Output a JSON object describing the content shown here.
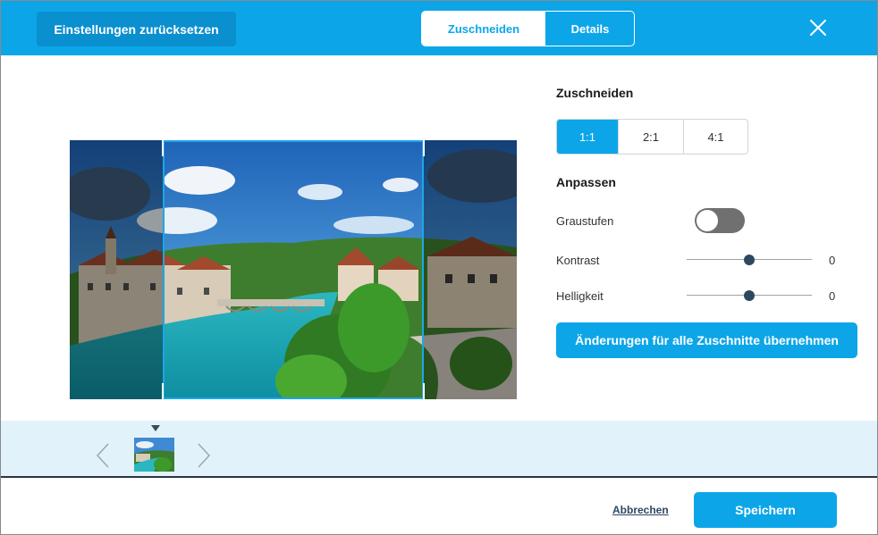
{
  "header": {
    "reset_label": "Einstellungen zurücksetzen",
    "tabs": [
      {
        "label": "Zuschneiden",
        "active": true
      },
      {
        "label": "Details",
        "active": false
      }
    ],
    "close_icon": "close-icon"
  },
  "crop": {
    "title": "Zuschneiden",
    "ratios": [
      {
        "label": "1:1",
        "active": true
      },
      {
        "label": "2:1",
        "active": false
      },
      {
        "label": "4:1",
        "active": false
      }
    ]
  },
  "adjust": {
    "title": "Anpassen",
    "grayscale_label": "Graustufen",
    "grayscale_on": false,
    "contrast_label": "Kontrast",
    "contrast_value": "0",
    "brightness_label": "Helligkeit",
    "brightness_value": "0",
    "apply_label": "Änderungen für alle Zuschnitte übernehmen"
  },
  "footer": {
    "cancel_label": "Abbrechen",
    "save_label": "Speichern"
  },
  "colors": {
    "accent": "#0ca6e8",
    "dark_button": "#0a8fcf",
    "strip_bg": "#e2f2fa",
    "slider_thumb": "#2e4761"
  }
}
